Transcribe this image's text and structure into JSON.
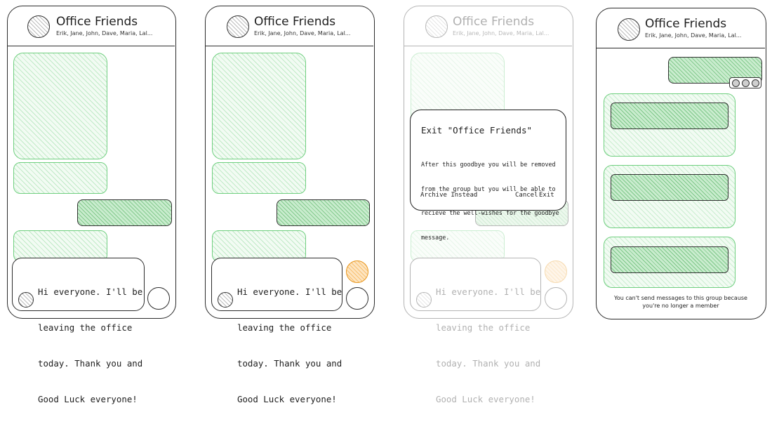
{
  "chat": {
    "title": "Office Friends",
    "members": "Erik, Jane, John, Dave, Maria, Lal..."
  },
  "compose": {
    "message_lines": [
      "Hi everyone. I'll be",
      "leaving the office",
      "today. Thank you and",
      "Good Luck everyone!"
    ]
  },
  "exit_dialog": {
    "title": "Exit \"Office Friends\"",
    "body_lines": [
      "After this goodbye you will be removed",
      "from the group but you will be able to",
      "recieve the well-wishes for the goodbye",
      "message."
    ],
    "archive_label": "Archive Instead",
    "cancel_label": "Cancel",
    "exit_label": "Exit"
  },
  "after_exit": {
    "notice_lines": [
      "You can't send messages to this group because",
      "you're no longer a member"
    ]
  },
  "colors": {
    "incoming_bubble": "#6fcf7f",
    "outgoing_bubble": "#4caf5a",
    "reaction": "#e8961c",
    "ink": "#1e1e1e"
  }
}
